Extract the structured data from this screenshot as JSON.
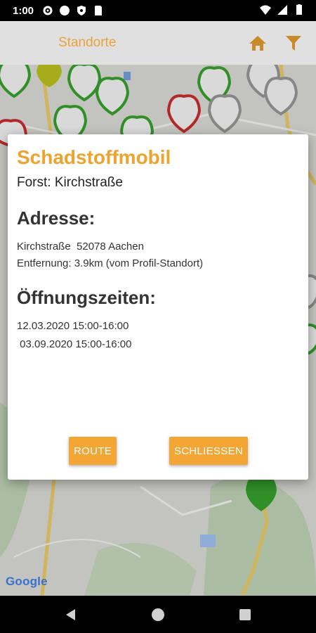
{
  "status_bar": {
    "time": "1:00",
    "icons_left": [
      "gear-icon",
      "circle-icon",
      "shield-icon",
      "sd-card-icon"
    ],
    "icons_right": [
      "wifi-icon",
      "signal-icon",
      "battery-icon"
    ]
  },
  "app_bar": {
    "title": "Standorte",
    "icons": [
      "home-icon",
      "filter-icon"
    ],
    "accent_color": "#e8a33c"
  },
  "map": {
    "attribution": "Google",
    "marker_colors": {
      "available": "#3aa830",
      "unavailable": "#9e9e9e",
      "mobile": "#d32f2f",
      "other": "#c5cc1f"
    }
  },
  "dialog": {
    "title": "Schadstoffmobil",
    "subtitle": "Forst: Kirchstraße",
    "address_heading": "Adresse:",
    "address_line": "Kirchstraße  52078 Aachen",
    "distance_line": "Entfernung: 3.9km (vom Profil-Standort)",
    "hours_heading": "Öffnungszeiten:",
    "hours": [
      "12.03.2020 15:00-16:00",
      " 03.09.2020 15:00-16:00"
    ],
    "route_button": "ROUTE",
    "close_button": "SCHLIESSEN",
    "title_color": "#f0a22e",
    "button_color": "#f3a633"
  },
  "nav_bar": {
    "icons": [
      "back-icon",
      "home-circle-icon",
      "recents-icon"
    ]
  }
}
